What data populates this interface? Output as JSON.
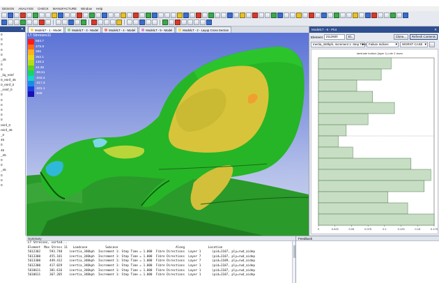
{
  "menu": [
    "DESIGN",
    "ANALYSIS",
    "CHECK",
    "MANUFACTURE",
    "Window",
    "Help"
  ],
  "left_panel": {
    "close": "✕",
    "items": [
      "",
      "",
      "0",
      "0",
      "0",
      "0",
      "0",
      "_45",
      "0",
      "0",
      "_liq_reinf",
      "0_reinf_45",
      "0_reinf_0",
      "_reinf_0",
      "0",
      "0",
      "0",
      "0",
      "0",
      "0",
      "reinf_0",
      "reinf_45",
      "_0",
      "45",
      "0",
      "45",
      "_45",
      "0",
      "0",
      "_45",
      "",
      "",
      "0",
      "0",
      "0"
    ]
  },
  "tabs": [
    {
      "label": "ModelLT - 1 - Model",
      "color": "#f5d94a"
    },
    {
      "label": "ModelLT - 3 - Model",
      "color": "#8ed07a"
    },
    {
      "label": "ModelLT - 4 - Model",
      "color": "#e9827c"
    },
    {
      "label": "ModelLT - 5 - Model",
      "color": "#d58ad6"
    },
    {
      "label": "ModelLT - 2 - Layup Cross Section",
      "color": "#f5d94a"
    }
  ],
  "viewport": {
    "legend_title": "LT Stresses11",
    "legend_values": [
      "593.7",
      "479.9",
      "366",
      "252.1",
      "138.2",
      "24.36",
      "-89.51",
      "-203.4",
      "-317.3",
      "-431.1",
      "-545"
    ],
    "legend_colors": [
      "#ff1a1a",
      "#ff6a1a",
      "#ffb21a",
      "#e6d81a",
      "#b8dc1a",
      "#5ed21a",
      "#1ad26c",
      "#1ad2c8",
      "#1a8ce6",
      "#1a3ee6",
      "#1a10b4"
    ]
  },
  "right_panel": {
    "tab": "ModelLT - 6 - Plot",
    "close": "✕",
    "element_label": "Element",
    "element_value": "2112920",
    "el_button": "El..",
    "clone_button": "Clone...",
    "refresh_button": "Refresh Contents",
    "load_select": "Inertia_340kph, Increment 1: Step Time",
    "mode_select": "Failure Indices",
    "case_select": "WORST CASE",
    "plot_title": "laminate bottom (layer 1) rule 2 down",
    "x_ticks": [
      "0",
      "0.025",
      "0.05",
      "0.075",
      "0.1",
      "0.125",
      "0.15",
      "0.175"
    ]
  },
  "chart_data": {
    "type": "bar",
    "orientation": "horizontal",
    "title": "laminate bottom (layer 1) rule 2 down",
    "xlabel": "",
    "ylabel": "",
    "xlim": [
      0,
      0.175
    ],
    "x_ticks": [
      0,
      0.025,
      0.05,
      0.075,
      0.1,
      0.125,
      0.15,
      0.175
    ],
    "values": [
      0.11,
      0.095,
      0.058,
      0.082,
      0.115,
      0.075,
      0.042,
      0.03,
      0.052,
      0.14,
      0.17,
      0.16,
      0.105,
      0.135,
      0.175
    ]
  },
  "summary": {
    "title": "Summary",
    "lines": [
      "LT Stresses, sorted...",
      "Element  Max Stress 11   Loadcase          Subcase                                Along             Location",
      "5612302     593.748    inertia_340kph  Increment 1: Step Time = 1.000  Fibre Directions  Layer 1      (pid=1107, ply=rwd_aidep",
      "5613300     455.101    inertia_340kph  Increment 1: Step Time = 1.000  Fibre Directions  Layer 7      (pid=1107, ply=rwd_aidep",
      "5613300     449.412    inertia_340kph  Increment 1: Step Time = 1.000  Fibre Directions  Layer 7      (pid=1109, ply=rwd_aidep",
      "5612300     417.029    inertia_340kph  Increment 1: Step Time = 1.000  Fibre Directions  Layer 1      (pid=1107, ply=rwd_aidep",
      "5610611     381.616    inertia_340kph  Increment 1: Step Time = 1.000  Fibre Directions  Layer 1      (pid=1107, ply=rwd_aidep",
      "5610611     367.205    inertia_340kph  Increment 1: Step Time = 1.000  Fibre Directions  Layer 1      (pid=1107, ply=rwd_aidep"
    ]
  },
  "feedback": {
    "title": "Feedback"
  }
}
